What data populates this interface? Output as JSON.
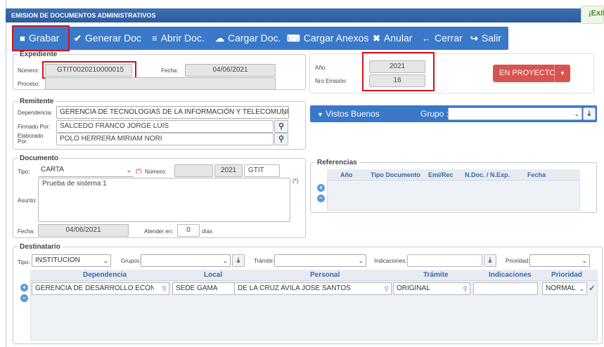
{
  "window": {
    "title": "EMISION DE DOCUMENTOS ADMINISTRATIVOS",
    "exit_label": "¡Exit"
  },
  "toolbar": [
    {
      "icon": "save-icon",
      "glyph": "■",
      "label": "Grabar"
    },
    {
      "icon": "generate-doc-icon",
      "glyph": "✔",
      "label": "Generar Doc"
    },
    {
      "icon": "open-doc-icon",
      "glyph": "≡",
      "label": "Abrir Doc."
    },
    {
      "icon": "upload-icon",
      "glyph": "☁",
      "label": "Cargar Doc."
    },
    {
      "icon": "paperclip-icon",
      "glyph": "⎘",
      "label": "Cargar Anexos"
    },
    {
      "icon": "cancel-icon",
      "glyph": "✖",
      "label": "Anular"
    },
    {
      "icon": "arrow-left-icon",
      "glyph": "←",
      "label": "Cerrar"
    },
    {
      "icon": "sign-out-icon",
      "glyph": "↪",
      "label": "Salir"
    }
  ],
  "expediente": {
    "legend": "Expediente",
    "numero_label": "Número:",
    "numero": "GTIT0020210000015",
    "fecha_label": "Fecha:",
    "fecha": "04/06/2021",
    "proceso_label": "Proceso:",
    "proceso": "",
    "anio_label": "Año:",
    "anio": "2021",
    "nro_emision_label": "Nro Emisión:",
    "nro_emision": "16",
    "status_label": "EN PROYECTO"
  },
  "remitente": {
    "legend": "Remitente",
    "dependencia_label": "Dependencia:",
    "dependencia": "GERENCIA DE TECNOLOGIAS DE LA INFORMACIÓN Y TELECOMUNI",
    "firmado_label": "Firmado Por:",
    "firmado": "SALCEDO FRANCO JORGE LUIS",
    "elaborado_label": "Elaborado Por:",
    "elaborado": "POLO HERRERA MIRIAM NORI"
  },
  "vistos": {
    "label": "Vistos Buenos",
    "grupo_label": "Grupo :"
  },
  "documento": {
    "legend": "Documento",
    "tipo_label": "Tipo:",
    "tipo": "CARTA",
    "req": "(*)",
    "numero_label": "Número:",
    "numero": "",
    "anio": "2021",
    "siglas": "GTIT",
    "asunto_label": "Asunto:",
    "asunto": "Prueba de sistema 1",
    "fecha_label": "Fecha:",
    "fecha": "04/06/2021",
    "atender_label": "Atender en:",
    "atender": "0",
    "dias_label": "días"
  },
  "referencias": {
    "legend": "Referencias",
    "columns": [
      "Año",
      "Tipo Documento",
      "Emi/Rec",
      "N.Doc. / N.Exp.",
      "Fecha"
    ]
  },
  "destinatario": {
    "legend": "Destinatario",
    "tipo_label": "Tipo:",
    "tipo": "INSTITUCION",
    "grupos_label": "Grupos:",
    "grupos": "",
    "tramite_label": "Trámite:",
    "tramite": "",
    "indicaciones_label": "Indicaciones:",
    "indicaciones": "",
    "prioridad_label": "Prioridad:",
    "prioridad": "",
    "columns": [
      "Dependencia",
      "Local",
      "Personal",
      "Trámite",
      "Indicaciones",
      "Prioridad"
    ],
    "rows": [
      {
        "dependencia": "GERENCIA DE DESARROLLO ECONO",
        "local": "SEDE GAMA",
        "personal": "DE LA CRUZ AVILA JOSE SANTOS",
        "tramite": "ORIGINAL",
        "indicaciones": "",
        "prioridad": "NORMAL"
      }
    ]
  },
  "colors": {
    "toolbar": "#3a78c9",
    "highlight": "#d4121f",
    "status": "#d9534f",
    "titlebar": "#2f5f9f"
  }
}
